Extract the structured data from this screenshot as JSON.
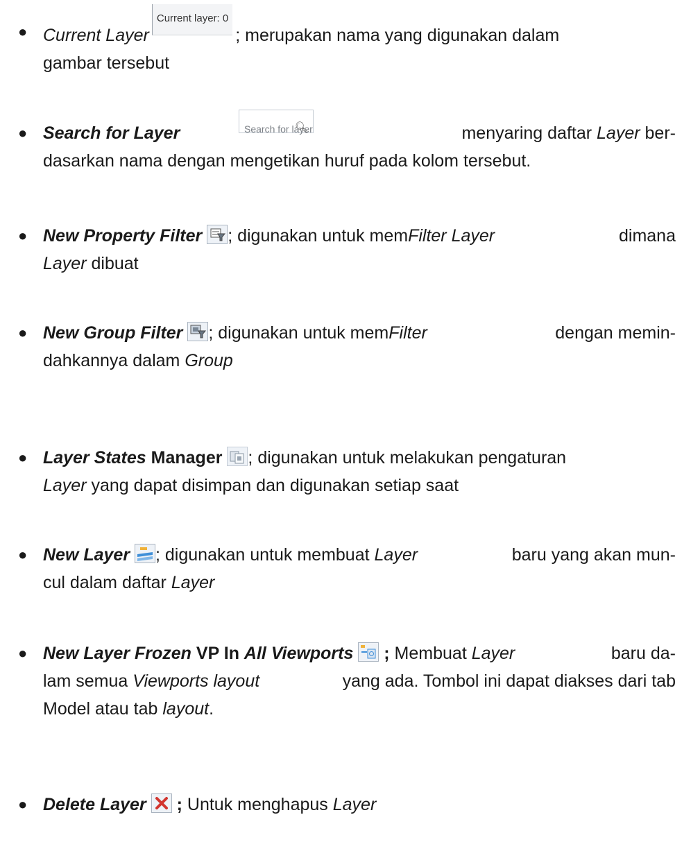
{
  "items": [
    {
      "term": "Current Layer",
      "widget": "Current layer: 0",
      "text": "; merupakan nama yang digunakan dalam",
      "text2": "gambar tersebut"
    },
    {
      "term": "Search for Layer",
      "widget_placeholder": "Search for layer",
      "text": "menyaring daftar",
      "text_italic": "Layer",
      "text_tail": "ber-",
      "text2": "dasarkan nama dengan mengetikan huruf pada kolom tersebut."
    },
    {
      "term": "New Property Filter",
      "icon": "property-filter-icon",
      "text": "; digunakan untuk mem",
      "text_italic": "Filter Layer",
      "text_tail": "dimana",
      "text2_italic": "Layer",
      "text2": "dibuat"
    },
    {
      "term": "New Group Filter",
      "icon": "group-filter-icon",
      "text": "; digunakan untuk mem",
      "text_italic": "Filter",
      "text_tail": "dengan memin-",
      "text2": "dahkannya dalam",
      "text2_italic": "Group"
    },
    {
      "term": "Layer States",
      "term_plain": "Manager",
      "icon": "layer-states-icon",
      "text": "; digunakan untuk melakukan pengaturan",
      "text2_italic": "Layer",
      "text2": "yang dapat disimpan dan digunakan  setiap saat"
    },
    {
      "term": "New Layer",
      "icon": "new-layer-icon",
      "text": "; digunakan untuk membuat",
      "text_italic": "Layer",
      "text_tail": "baru yang akan mun-",
      "text2": "cul dalam daftar",
      "text2_italic": "Layer"
    },
    {
      "term": "New Layer Frozen",
      "term_plain": "VP In",
      "term2": "All Viewports",
      "icon": "new-layer-vp-frozen-icon",
      "semicolon": ";",
      "text": "Membuat",
      "text_italic": "Layer",
      "text_tail": "baru da-",
      "text2": "lam semua",
      "text2_italic": "Viewports layout",
      "text2_tail": "yang ada. Tombol ini dapat diakses dari tab",
      "text3": "Model atau tab",
      "text3_italic": "layout",
      "text3_tail": "."
    },
    {
      "term": "Delete Layer",
      "icon": "delete-icon",
      "semicolon": ";",
      "text": "Untuk menghapus",
      "text_italic": "Layer"
    }
  ]
}
